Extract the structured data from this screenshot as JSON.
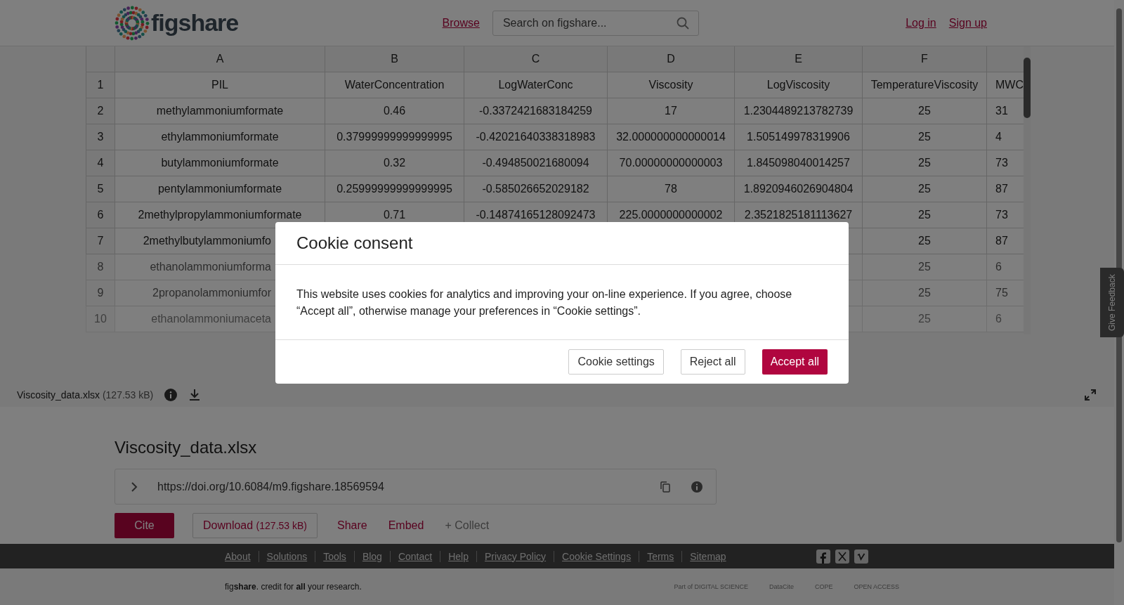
{
  "header": {
    "logo_text": "figshare",
    "nav_link": "Browse",
    "search": {
      "placeholder": "Search on figshare..."
    },
    "auth_links": [
      "Log in",
      "Sign up"
    ]
  },
  "sheet": {
    "columns": [
      "A",
      "B",
      "C",
      "D",
      "E",
      "F"
    ],
    "rows": [
      {
        "n": "1",
        "obscured": false,
        "under_dialog": false,
        "cells": [
          "PIL",
          "WaterConcentration",
          "LogWaterConc",
          "Viscosity",
          "LogViscosity",
          "TemperatureViscosity",
          "MWC"
        ]
      },
      {
        "n": "2",
        "obscured": false,
        "under_dialog": false,
        "cells": [
          "methylammoniumformate",
          "0.46",
          "-0.3372421683184259",
          "17",
          "1.2304489213782739",
          "25",
          "31"
        ]
      },
      {
        "n": "3",
        "obscured": false,
        "under_dialog": false,
        "cells": [
          "ethylammoniumformate",
          "0.37999999999999995",
          "-0.42021640338318983",
          "32.000000000000014",
          "1.505149978319906",
          "25",
          "4"
        ]
      },
      {
        "n": "4",
        "obscured": false,
        "under_dialog": false,
        "cells": [
          "butylammoniumformate",
          "0.32",
          "-0.494850021680094",
          "70.00000000000003",
          "1.845098040014257",
          "25",
          "73"
        ]
      },
      {
        "n": "5",
        "obscured": false,
        "under_dialog": false,
        "cells": [
          "pentylammoniumformate",
          "0.25999999999999995",
          "-0.585026652029182",
          "78",
          "1.8920946026904804",
          "25",
          "87"
        ]
      },
      {
        "n": "6",
        "obscured": false,
        "under_dialog": false,
        "cells": [
          "2methylpropylammoniumformate",
          "0.71",
          "-0.14874165128092473",
          "225.0000000000002",
          "2.3521825181113627",
          "25",
          "73"
        ]
      },
      {
        "n": "7",
        "obscured": false,
        "under_dialog": true,
        "cells": [
          "2methylbutylammoniumfo",
          null,
          null,
          null,
          null,
          "25",
          "87"
        ]
      },
      {
        "n": "8",
        "obscured": true,
        "under_dialog": true,
        "cells": [
          "ethanolammoniumforma",
          null,
          null,
          null,
          null,
          "25",
          "6"
        ]
      },
      {
        "n": "9",
        "obscured": true,
        "under_dialog": true,
        "cells": [
          "2propanolammoniumfor",
          null,
          null,
          null,
          null,
          "25",
          "75"
        ]
      },
      {
        "n": "10",
        "obscured": true,
        "under_dialog": true,
        "cells": [
          "ethanolammoniumaceta",
          null,
          null,
          null,
          null,
          "25",
          "6"
        ]
      }
    ]
  },
  "file_bar": {
    "name": "Viscosity_data.xlsx",
    "size": "(127.53 kB)"
  },
  "article": {
    "title": "Viscosity_data.xlsx",
    "doi": "https://doi.org/10.6084/m9.figshare.18569594",
    "actions": [
      {
        "kind": "primary",
        "label": "Cite"
      },
      {
        "kind": "outlined",
        "label": "Download",
        "size": "(127.53 kB)"
      },
      {
        "kind": "link",
        "label": "Share"
      },
      {
        "kind": "link",
        "label": "Embed"
      },
      {
        "kind": "muted",
        "label": "+ Collect"
      }
    ]
  },
  "footer": {
    "links": [
      "About",
      "Solutions",
      "Tools",
      "Blog",
      "Contact",
      "Help",
      "Privacy Policy",
      "Cookie Settings",
      "Terms",
      "Sitemap"
    ],
    "tagline": "fig**share**. credit for **all** your research.",
    "partners": [
      "Part of DIGITAL SCIENCE",
      "DataCite",
      "COPE",
      "OPEN ACCESS"
    ]
  },
  "feedback_tab": "Give Feedback",
  "cookie_dialog": {
    "title": "Cookie consent",
    "text": "This website uses cookies for analytics and improving your on-line experience. If you agree, choose “Accept all”, otherwise manage your preferences in “Cookie settings”.",
    "buttons": [
      {
        "kind": "secondary",
        "label": "Cookie settings"
      },
      {
        "kind": "secondary",
        "label": "Reject all"
      },
      {
        "kind": "primary",
        "label": "Accept all"
      }
    ]
  }
}
